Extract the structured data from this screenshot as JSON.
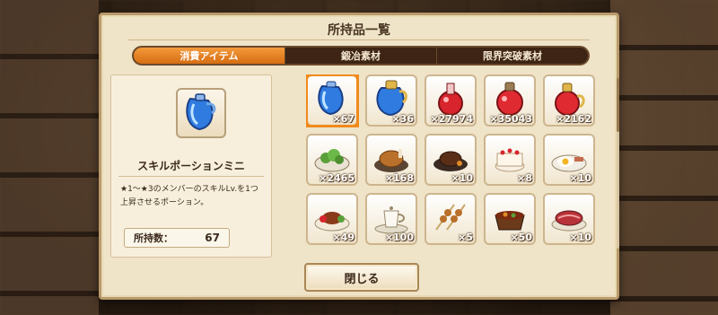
{
  "dialog": {
    "title": "所持品一覧",
    "close_label": "閉じる"
  },
  "tabs": [
    {
      "label": "消費アイテム",
      "active": true
    },
    {
      "label": "鍛冶素材",
      "active": false
    },
    {
      "label": "限界突破素材",
      "active": false
    }
  ],
  "detail": {
    "icon": "skill-potion-mini-icon",
    "name": "スキルポーションミニ",
    "description": "★1～★3のメンバーのスキルLv.を1つ上昇させるポーション。",
    "owned_label": "所持数：",
    "owned_value": "67"
  },
  "items": [
    {
      "icon": "blue-potion-small-icon",
      "count": "×67",
      "selected": true
    },
    {
      "icon": "blue-potion-large-icon",
      "count": "×36"
    },
    {
      "icon": "red-potion-small-icon",
      "count": "×27974"
    },
    {
      "icon": "red-potion-medium-icon",
      "count": "×35043"
    },
    {
      "icon": "red-potion-large-icon",
      "count": "×2162"
    },
    {
      "icon": "salad-icon",
      "count": "×2465"
    },
    {
      "icon": "roast-chicken-icon",
      "count": "×168"
    },
    {
      "icon": "hamburg-steak-icon",
      "count": "×10"
    },
    {
      "icon": "cake-icon",
      "count": "×8"
    },
    {
      "icon": "fried-egg-breakfast-icon",
      "count": "×10"
    },
    {
      "icon": "meat-dish-icon",
      "count": "×49"
    },
    {
      "icon": "tea-set-icon",
      "count": "×100"
    },
    {
      "icon": "skewers-icon",
      "count": "×5"
    },
    {
      "icon": "stew-pot-icon",
      "count": "×50"
    },
    {
      "icon": "roast-beef-icon",
      "count": "×10"
    }
  ],
  "colors": {
    "accent": "#f08a1c",
    "frame": "#b99a6a",
    "panel": "#efe3c8",
    "tab_bar": "#3d2414"
  }
}
